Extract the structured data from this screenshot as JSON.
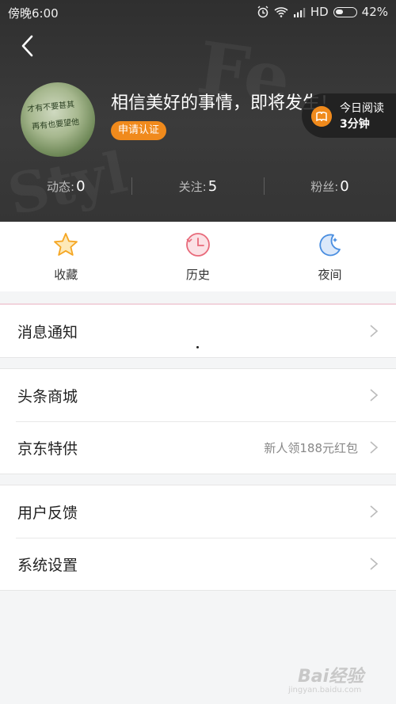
{
  "status_bar": {
    "time": "傍晚6:00",
    "network": "HD",
    "battery": "42%"
  },
  "profile": {
    "username": "相信美好的事情，即将发生！",
    "verify_label": "申请认证",
    "avatar_calligraphy": [
      "才有不要甚其",
      "再有也要望他"
    ]
  },
  "reading": {
    "line1": "今日阅读",
    "line2": "3分钟"
  },
  "stats": [
    {
      "label": "动态:",
      "value": "0"
    },
    {
      "label": "关注:",
      "value": "5"
    },
    {
      "label": "粉丝:",
      "value": "0"
    }
  ],
  "quick_actions": [
    {
      "label": "收藏",
      "icon": "star-icon"
    },
    {
      "label": "历史",
      "icon": "clock-icon"
    },
    {
      "label": "夜间",
      "icon": "moon-icon"
    }
  ],
  "menu": {
    "notifications": "消息通知",
    "mall": "头条商城",
    "jd": "京东特供",
    "jd_extra": "新人领188元红包",
    "feedback": "用户反馈",
    "settings": "系统设置"
  },
  "watermark": {
    "text": "Bai经验",
    "sub": "jingyan.baidu.com"
  },
  "colors": {
    "accent": "#f08a1c",
    "header_bg": "#353535",
    "star": "#f5a623",
    "clock": "#e86a7a",
    "moon": "#4a8ee0"
  }
}
